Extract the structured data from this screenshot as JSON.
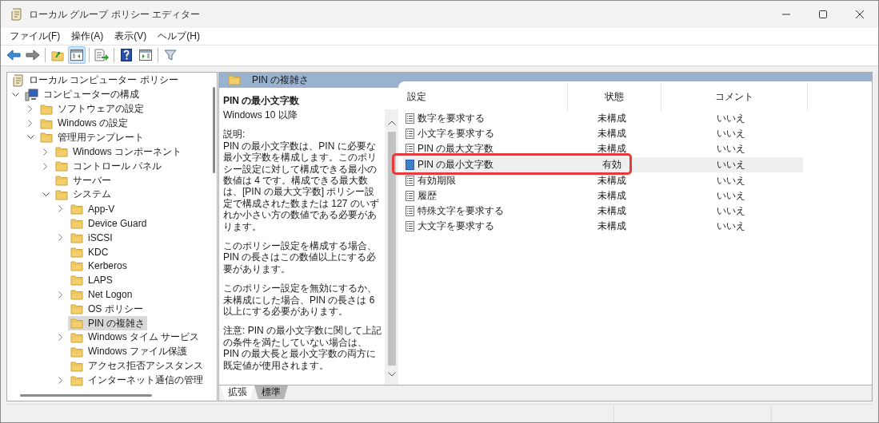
{
  "window": {
    "title": "ローカル グループ ポリシー エディター"
  },
  "menu": [
    "ファイル(F)",
    "操作(A)",
    "表示(V)",
    "ヘルプ(H)"
  ],
  "toolbar": [
    {
      "kind": "back",
      "pressed": false
    },
    {
      "kind": "forward",
      "pressed": false
    },
    {
      "kind": "separator"
    },
    {
      "kind": "up",
      "pressed": false
    },
    {
      "kind": "console-tree",
      "pressed": true
    },
    {
      "kind": "separator"
    },
    {
      "kind": "export",
      "pressed": false
    },
    {
      "kind": "separator"
    },
    {
      "kind": "help",
      "pressed": false
    },
    {
      "kind": "action-pane",
      "pressed": false
    },
    {
      "kind": "separator"
    },
    {
      "kind": "filter",
      "pressed": false
    }
  ],
  "tree": [
    {
      "label": "ローカル コンピューター ポリシー",
      "kind": "policy",
      "selected": false,
      "children": [
        {
          "label": "コンピューターの構成",
          "kind": "computer",
          "expandable": true,
          "expanded": true,
          "selected": false,
          "children": [
            {
              "label": "ソフトウェアの設定",
              "kind": "folder",
              "expandable": true,
              "expanded": false,
              "selected": false
            },
            {
              "label": "Windows の設定",
              "kind": "folder",
              "expandable": true,
              "expanded": false,
              "selected": false
            },
            {
              "label": "管理用テンプレート",
              "kind": "folder",
              "expandable": true,
              "expanded": true,
              "selected": false,
              "children": [
                {
                  "label": "Windows コンポーネント",
                  "kind": "folder",
                  "expandable": true,
                  "expanded": false,
                  "selected": false
                },
                {
                  "label": "コントロール パネル",
                  "kind": "folder",
                  "expandable": true,
                  "expanded": false,
                  "selected": false
                },
                {
                  "label": "サーバー",
                  "kind": "folder",
                  "expandable": false,
                  "selected": false
                },
                {
                  "label": "システム",
                  "kind": "folder",
                  "expandable": true,
                  "expanded": true,
                  "selected": false,
                  "children": [
                    {
                      "label": "App-V",
                      "kind": "folder",
                      "expandable": true,
                      "expanded": false,
                      "selected": false
                    },
                    {
                      "label": "Device Guard",
                      "kind": "folder",
                      "expandable": false,
                      "selected": false
                    },
                    {
                      "label": "iSCSI",
                      "kind": "folder",
                      "expandable": true,
                      "expanded": false,
                      "selected": false
                    },
                    {
                      "label": "KDC",
                      "kind": "folder",
                      "expandable": false,
                      "selected": false
                    },
                    {
                      "label": "Kerberos",
                      "kind": "folder",
                      "expandable": false,
                      "selected": false
                    },
                    {
                      "label": "LAPS",
                      "kind": "folder",
                      "expandable": false,
                      "selected": false
                    },
                    {
                      "label": "Net Logon",
                      "kind": "folder",
                      "expandable": true,
                      "expanded": false,
                      "selected": false
                    },
                    {
                      "label": "OS ポリシー",
                      "kind": "folder",
                      "expandable": false,
                      "selected": false
                    },
                    {
                      "label": "PIN の複雑さ",
                      "kind": "folder",
                      "expandable": false,
                      "selected": true
                    },
                    {
                      "label": "Windows タイム サービス",
                      "kind": "folder",
                      "expandable": true,
                      "expanded": false,
                      "selected": false
                    },
                    {
                      "label": "Windows ファイル保護",
                      "kind": "folder",
                      "expandable": false,
                      "selected": false
                    },
                    {
                      "label": "アクセス拒否アシスタンス",
                      "kind": "folder",
                      "expandable": false,
                      "selected": false
                    },
                    {
                      "label": "インターネット通信の管理",
                      "kind": "folder",
                      "expandable": true,
                      "expanded": false,
                      "selected": false
                    }
                  ]
                }
              ]
            }
          ]
        }
      ]
    }
  ],
  "details": {
    "header": "PIN の複雑さ",
    "description": {
      "title": "PIN の最小文字数",
      "blocks": [
        [
          "Windows 10 以降"
        ],
        [
          "説明:",
          "PIN の最小文字数は、PIN に必要な最小文字数を構成します。このポリシー設定に対して構成できる最小の数値は 4 です。構成できる最大数は、[PIN の最大文字数] ポリシー設定で構成された数または 127 のいずれか小さい方の数値である必要があります。"
        ],
        [
          "このポリシー設定を構成する場合、PIN の長さはこの数値以上にする必要があります。"
        ],
        [
          "このポリシー設定を無効にするか、未構成にした場合、PIN の長さは 6 以上にする必要があります。"
        ],
        [
          "注意: PIN の最小文字数に関して上記の条件を満たしていない場合は、PIN の最大長と最小文字数の両方に既定値が使用されます。"
        ]
      ]
    },
    "table": {
      "columns": [
        "設定",
        "状態",
        "コメント"
      ],
      "rows": [
        {
          "kind": "setting",
          "selected": false,
          "highlighted": false,
          "cells": [
            "数字を要求する",
            "未構成",
            "いいえ"
          ]
        },
        {
          "kind": "setting",
          "selected": false,
          "highlighted": false,
          "cells": [
            "小文字を要求する",
            "未構成",
            "いいえ"
          ]
        },
        {
          "kind": "setting",
          "selected": false,
          "highlighted": false,
          "cells": [
            "PIN の最大文字数",
            "未構成",
            "いいえ"
          ]
        },
        {
          "kind": "enabled-setting",
          "selected": true,
          "highlighted": true,
          "cells": [
            "PIN の最小文字数",
            "有効",
            "いいえ"
          ]
        },
        {
          "kind": "setting",
          "selected": false,
          "highlighted": false,
          "cells": [
            "有効期限",
            "未構成",
            "いいえ"
          ]
        },
        {
          "kind": "setting",
          "selected": false,
          "highlighted": false,
          "cells": [
            "履歴",
            "未構成",
            "いいえ"
          ]
        },
        {
          "kind": "setting",
          "selected": false,
          "highlighted": false,
          "cells": [
            "特殊文字を要求する",
            "未構成",
            "いいえ"
          ]
        },
        {
          "kind": "setting",
          "selected": false,
          "highlighted": false,
          "cells": [
            "大文字を要求する",
            "未構成",
            "いいえ"
          ]
        }
      ]
    },
    "tabs": [
      {
        "label": "拡張",
        "selected": true
      },
      {
        "label": "標準",
        "selected": false
      }
    ]
  }
}
